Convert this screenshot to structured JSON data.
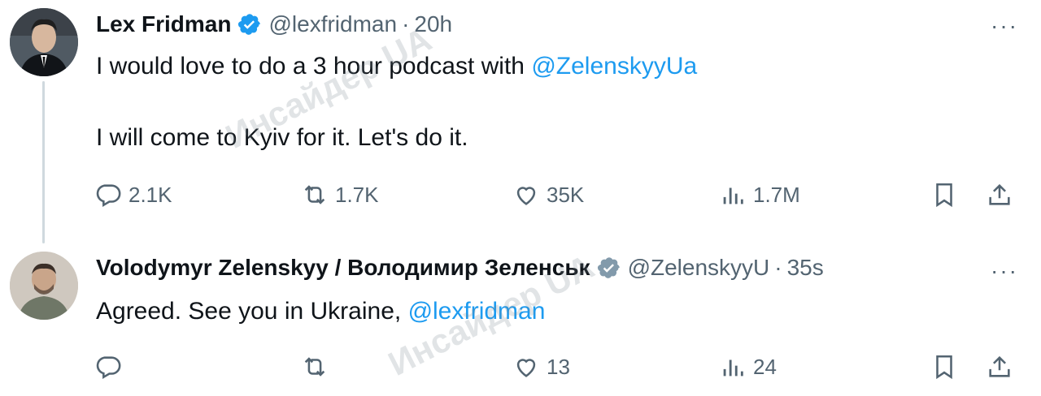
{
  "colors": {
    "link": "#1d9bf0",
    "muted": "#536471",
    "text": "#0f1419",
    "verified": "#1d9bf0"
  },
  "tweets": [
    {
      "name": "Lex Fridman",
      "handle": "@lexfridman",
      "separator": "·",
      "time": "20h",
      "more": "···",
      "lines": [
        {
          "pre": "I would love to do a 3 hour podcast with ",
          "mention": "@ZelenskyyUa"
        },
        {
          "pre": "I will come to Kyiv for it. Let's do it.",
          "mention": ""
        }
      ],
      "stats": {
        "replies": "2.1K",
        "reposts": "1.7K",
        "likes": "35K",
        "views": "1.7M"
      }
    },
    {
      "name": "Volodymyr Zelenskyy / Володимир Зеленськ",
      "handle": "@ZelenskyyU",
      "separator": "·",
      "time": "35s",
      "more": "···",
      "lines": [
        {
          "pre": "Agreed. See you in Ukraine, ",
          "mention": "@lexfridman"
        }
      ],
      "stats": {
        "replies": "",
        "reposts": "",
        "likes": "13",
        "views": "24"
      }
    }
  ],
  "watermark": {
    "text1": "Инсайдер UA",
    "text2": "Инсайдер UA"
  }
}
